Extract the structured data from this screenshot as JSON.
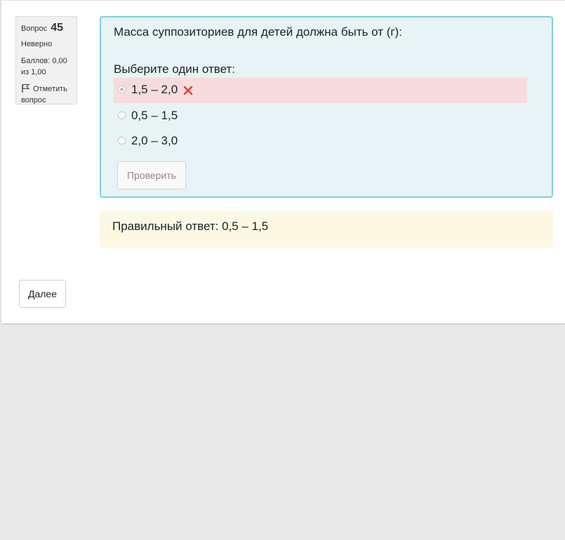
{
  "question_info": {
    "number_label": "Вопрос",
    "number": "45",
    "state": "Неверно",
    "grade": "Баллов: 0,00 из 1,00",
    "flag_label": "Отметить вопрос"
  },
  "question": {
    "text": "Масса суппозиториев для детей должна быть от (г):",
    "prompt": "Выберите один ответ:",
    "answers": [
      {
        "label": "1,5 – 2,0",
        "selected": true,
        "status": "incorrect"
      },
      {
        "label": "0,5 – 1,5",
        "selected": false,
        "status": ""
      },
      {
        "label": "2,0 – 3,0",
        "selected": false,
        "status": ""
      }
    ],
    "check_label": "Проверить"
  },
  "feedback": {
    "right_answer": "Правильный ответ: 0,5 – 1,5"
  },
  "navigation": {
    "next_label": "Далее"
  },
  "colors": {
    "formulation_bg": "#e7f3f5",
    "formulation_border": "#7fcfdf",
    "incorrect_bg": "#f6dcdc",
    "incorrect_icon": "#e53935",
    "feedback_bg": "#fcf8e3"
  },
  "icons": {
    "flag": "flag-icon",
    "incorrect": "x-mark-icon"
  }
}
